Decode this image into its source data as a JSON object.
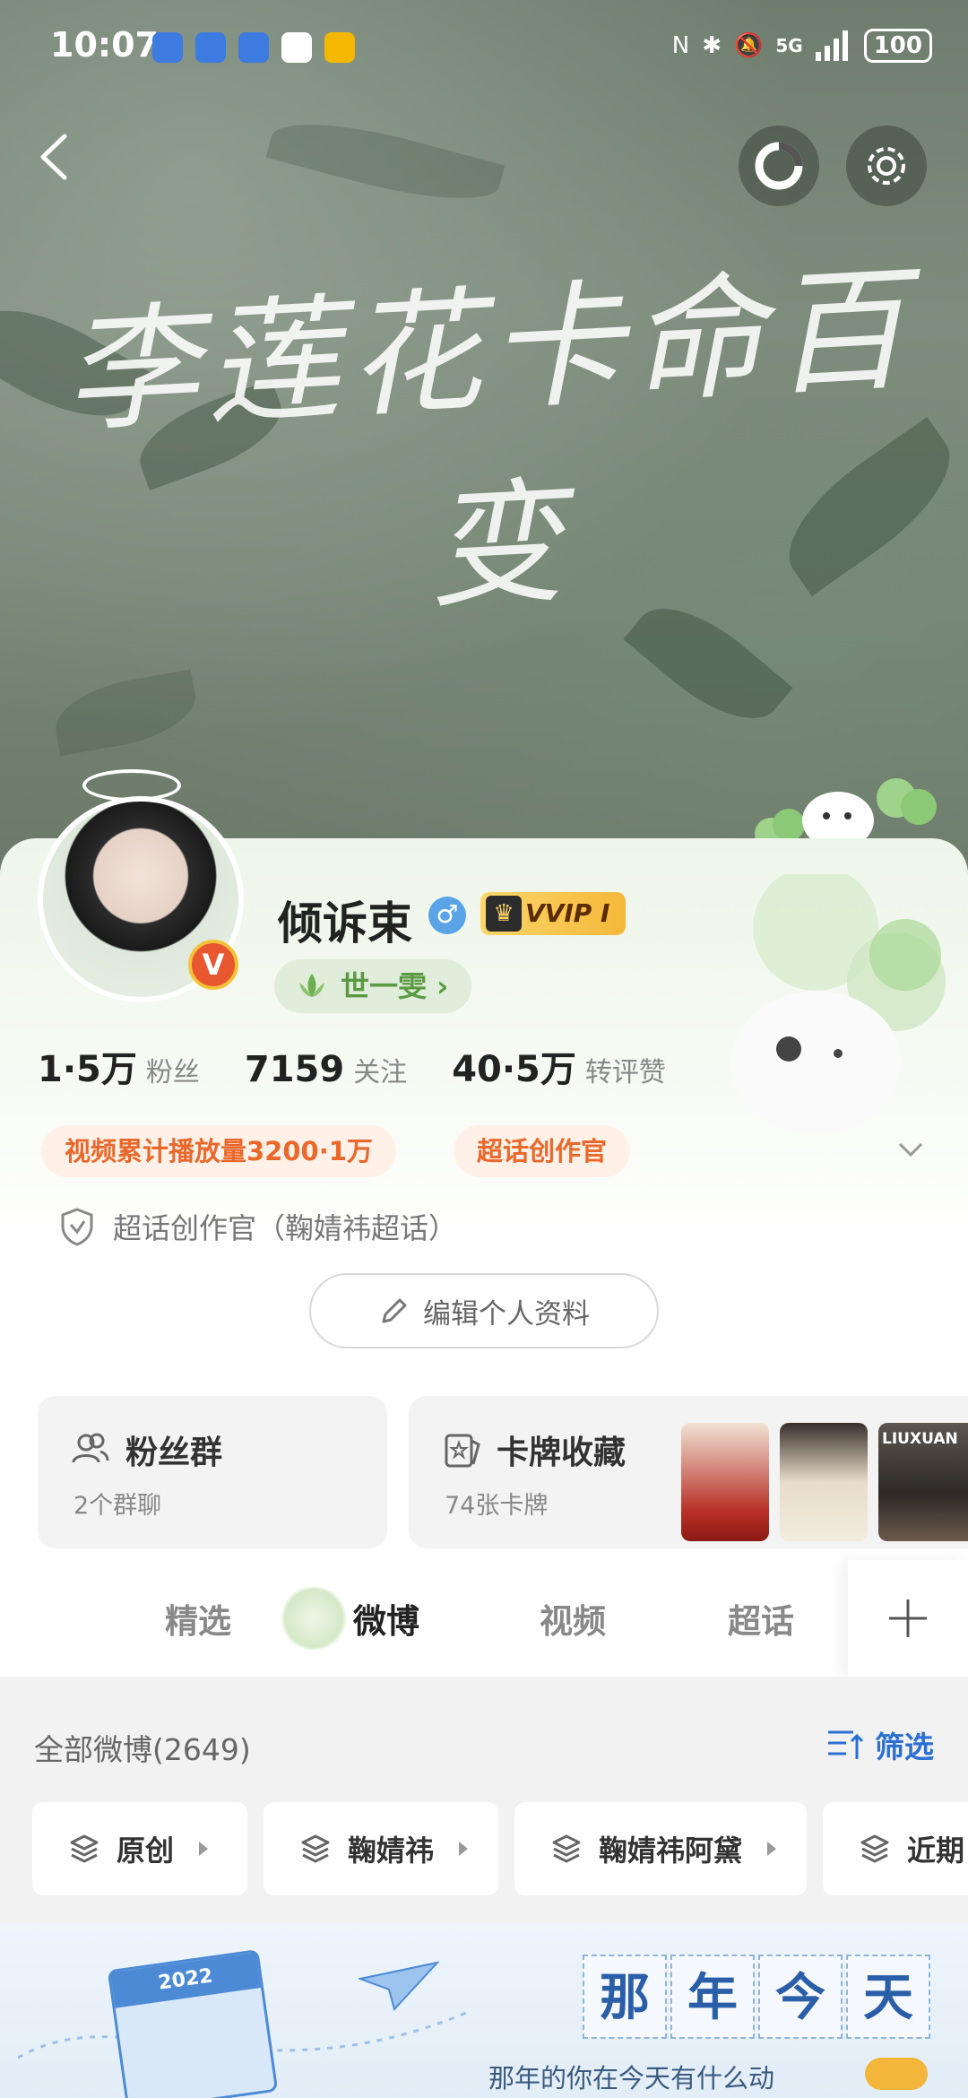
{
  "status_bar": {
    "time": "10:07",
    "battery": "100",
    "network": "5G"
  },
  "cover": {
    "calligraphy": "李莲花卡命百变"
  },
  "profile": {
    "username": "倾诉束",
    "gender_symbol": "♂",
    "vip_label": "VVIP I",
    "verified_badge": "V",
    "title_chip": "世一雯 ›",
    "stats": [
      {
        "value": "1·5万",
        "label": "粉丝"
      },
      {
        "value": "7159",
        "label": "关注"
      },
      {
        "value": "40·5万",
        "label": "转评赞"
      }
    ],
    "tags": [
      "视频累计播放量3200·1万",
      "超话创作官"
    ],
    "role_line": "超话创作官（鞠婧祎超话）",
    "edit_button": "编辑个人资料"
  },
  "cards": {
    "fans_group": {
      "title": "粉丝群",
      "subtitle": "2个群聊"
    },
    "card_collection": {
      "title": "卡牌收藏",
      "subtitle": "74张卡牌",
      "thumb_text": "LIUXUAN"
    }
  },
  "tabs": [
    "精选",
    "微博",
    "视频",
    "超话"
  ],
  "active_tab": "微博",
  "feed": {
    "title": "全部微博(2649)",
    "filter_label": "筛选",
    "chips": [
      "原创",
      "鞠婧祎",
      "鞠婧祎阿黛",
      "近期"
    ]
  },
  "banner": {
    "calendar_year": "2022",
    "stamps": [
      "那",
      "年",
      "今",
      "天"
    ],
    "caption": "那年的你在今天有什么动"
  },
  "colors": {
    "accent_blue": "#2c6fd2",
    "tag_orange": "#e9682c",
    "chip_green": "#5b9a43"
  }
}
